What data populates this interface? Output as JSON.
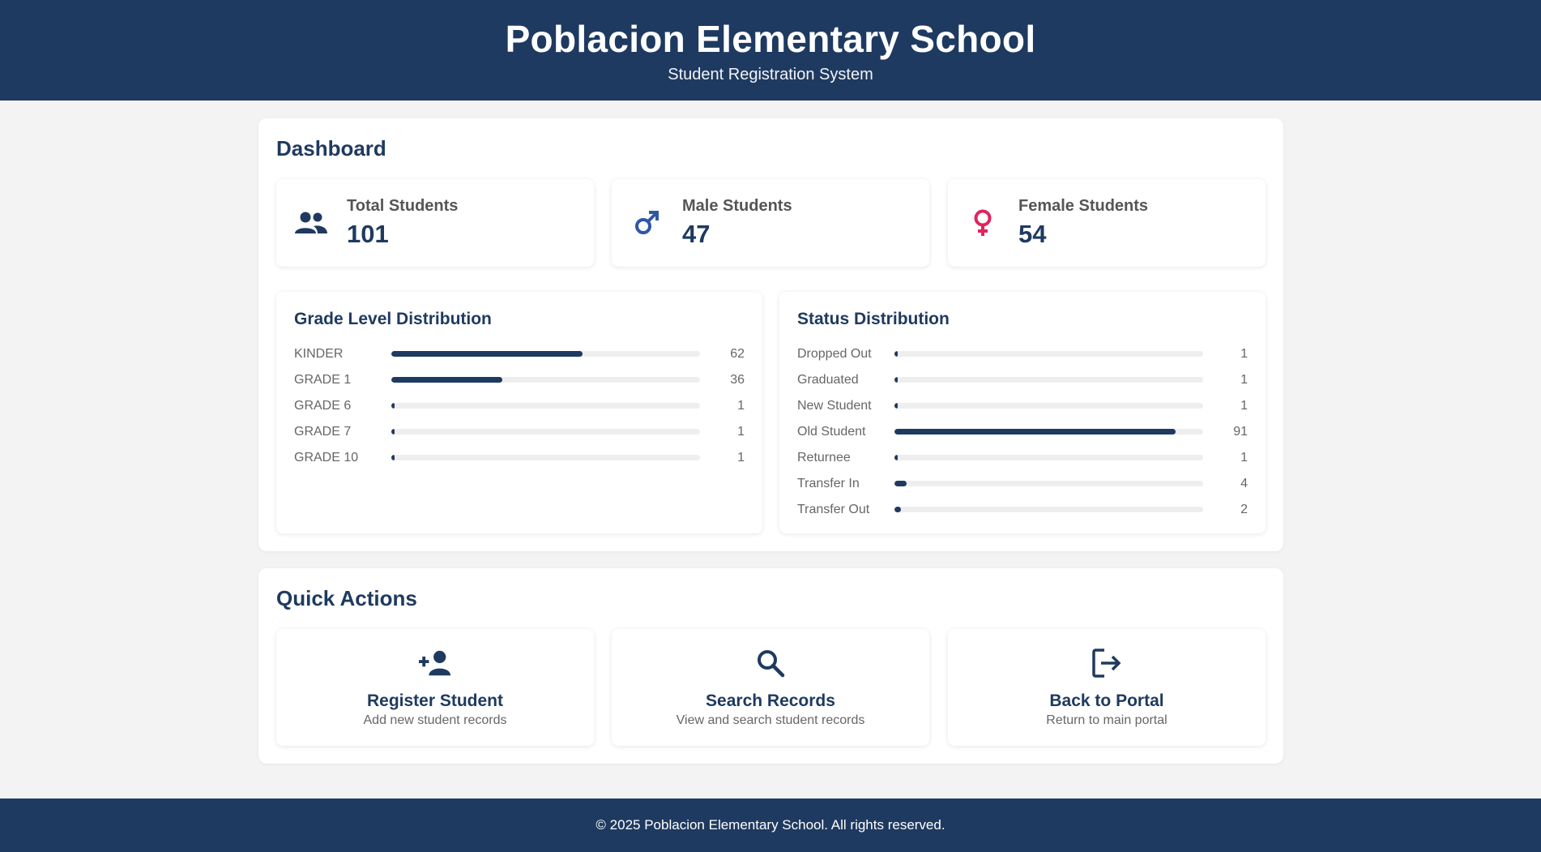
{
  "header": {
    "title": "Poblacion Elementary School",
    "subtitle": "Student Registration System"
  },
  "dashboard": {
    "title": "Dashboard",
    "stats": [
      {
        "label": "Total Students",
        "value": "101",
        "icon": "group-icon",
        "color": "#1f3a60"
      },
      {
        "label": "Male Students",
        "value": "47",
        "icon": "male-icon",
        "color": "#2f57a6"
      },
      {
        "label": "Female Students",
        "value": "54",
        "icon": "female-icon",
        "color": "#e0245e"
      }
    ],
    "grade_distribution": {
      "title": "Grade Level Distribution",
      "rows": [
        {
          "label": "KINDER",
          "count": "62",
          "fraction": 0.62
        },
        {
          "label": "GRADE 1",
          "count": "36",
          "fraction": 0.36
        },
        {
          "label": "GRADE 6",
          "count": "1",
          "fraction": 0.01
        },
        {
          "label": "GRADE 7",
          "count": "1",
          "fraction": 0.01
        },
        {
          "label": "GRADE 10",
          "count": "1",
          "fraction": 0.01
        }
      ]
    },
    "status_distribution": {
      "title": "Status Distribution",
      "rows": [
        {
          "label": "Dropped Out",
          "count": "1",
          "fraction": 0.01
        },
        {
          "label": "Graduated",
          "count": "1",
          "fraction": 0.01
        },
        {
          "label": "New Student",
          "count": "1",
          "fraction": 0.01
        },
        {
          "label": "Old Student",
          "count": "91",
          "fraction": 0.91
        },
        {
          "label": "Returnee",
          "count": "1",
          "fraction": 0.01
        },
        {
          "label": "Transfer In",
          "count": "4",
          "fraction": 0.04
        },
        {
          "label": "Transfer Out",
          "count": "2",
          "fraction": 0.02
        }
      ]
    }
  },
  "quick_actions": {
    "title": "Quick Actions",
    "items": [
      {
        "title": "Register Student",
        "desc": "Add new student records",
        "icon": "add-person-icon"
      },
      {
        "title": "Search Records",
        "desc": "View and search student records",
        "icon": "search-icon"
      },
      {
        "title": "Back to Portal",
        "desc": "Return to main portal",
        "icon": "logout-icon"
      }
    ]
  },
  "footer": {
    "copyright": "© 2025 Poblacion Elementary School. All rights reserved."
  },
  "colors": {
    "primary": "#1f3a60",
    "male": "#2f57a6",
    "female": "#e0245e",
    "background": "#f3f3f3"
  }
}
